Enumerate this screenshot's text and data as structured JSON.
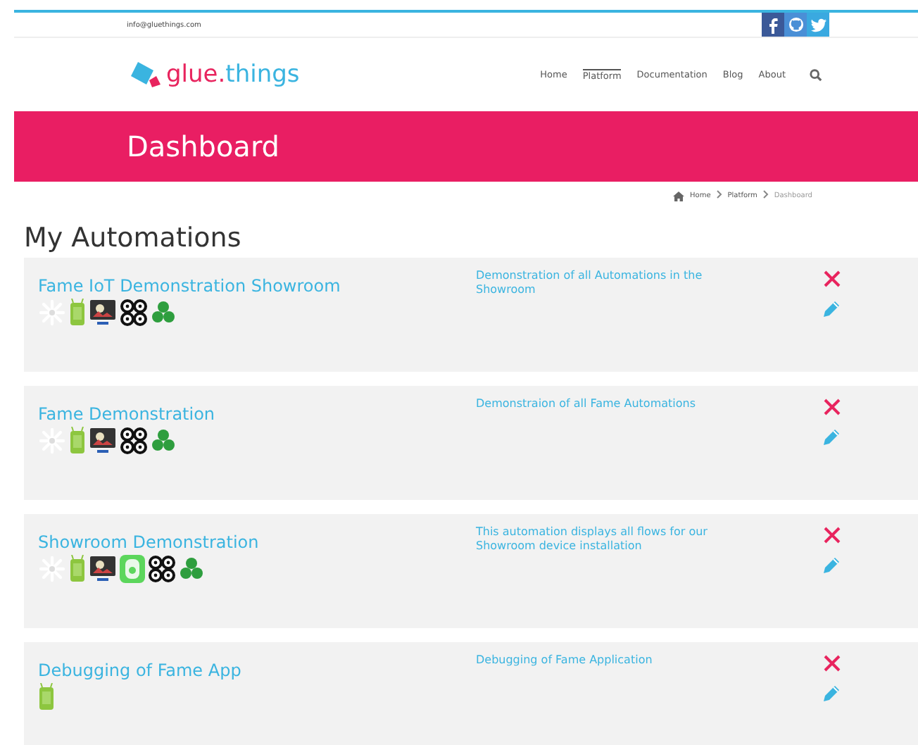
{
  "topbar": {
    "email": "info@gluethings.com",
    "social": [
      {
        "kind": "facebook"
      },
      {
        "kind": "github"
      },
      {
        "kind": "twitter"
      }
    ]
  },
  "header": {
    "logo_main": "glue",
    "logo_dot": ".",
    "logo_rest": "things",
    "nav": [
      {
        "label": "Home",
        "selected": false
      },
      {
        "label": "Platform",
        "selected": true
      },
      {
        "label": "Documentation",
        "selected": false
      },
      {
        "label": "Blog",
        "selected": false
      },
      {
        "label": "About",
        "selected": false
      }
    ]
  },
  "banner": {
    "title": "Dashboard"
  },
  "breadcrumb": [
    "Home",
    "Platform",
    "Dashboard"
  ],
  "heading": "My Automations",
  "automations": [
    {
      "title": "Fame IoT Demonstration Showroom",
      "description": "Demonstration of all Automations in the Showroom",
      "devices": [
        {
          "kind": "spark"
        },
        {
          "kind": "phone"
        },
        {
          "kind": "screen"
        },
        {
          "kind": "drone"
        },
        {
          "kind": "cluster"
        }
      ]
    },
    {
      "title": "Fame Demonstration",
      "description": "Demonstraion of all Fame Automations",
      "devices": [
        {
          "kind": "spark"
        },
        {
          "kind": "phone"
        },
        {
          "kind": "screen"
        },
        {
          "kind": "drone"
        },
        {
          "kind": "cluster"
        }
      ]
    },
    {
      "title": "Showroom Demonstration",
      "description": "This automation displays all flows for our Showroom device installation",
      "devices": [
        {
          "kind": "spark"
        },
        {
          "kind": "phone"
        },
        {
          "kind": "screen"
        },
        {
          "kind": "plug"
        },
        {
          "kind": "drone"
        },
        {
          "kind": "cluster"
        }
      ]
    },
    {
      "title": "Debugging of Fame App",
      "description": "Debugging of Fame Application",
      "devices": [
        {
          "kind": "phone"
        }
      ]
    }
  ]
}
